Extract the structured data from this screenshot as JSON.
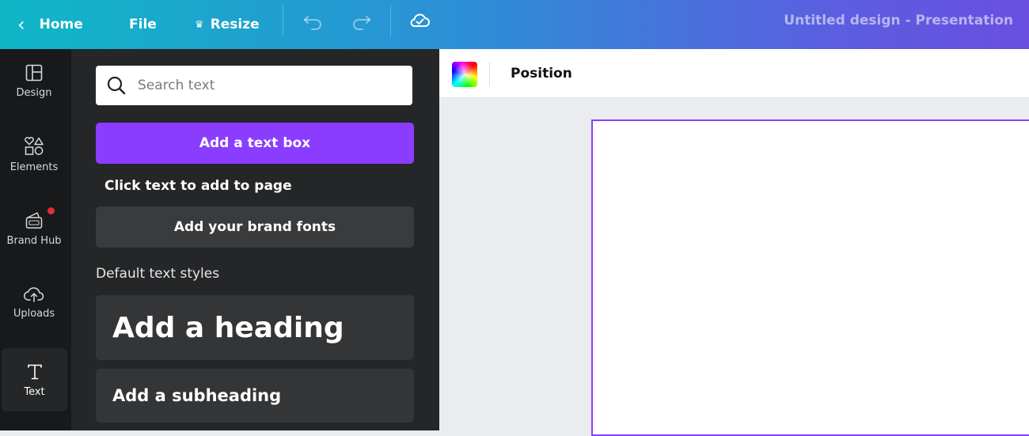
{
  "topbar": {
    "home_label": "Home",
    "file_label": "File",
    "resize_label": "Resize",
    "title": "Untitled design - Presentation"
  },
  "rail": {
    "items": [
      {
        "label": "Design",
        "icon": "layout-icon"
      },
      {
        "label": "Elements",
        "icon": "shapes-icon"
      },
      {
        "label": "Brand Hub",
        "icon": "brand-hub-icon"
      },
      {
        "label": "Uploads",
        "icon": "cloud-upload-icon"
      },
      {
        "label": "Text",
        "icon": "text-icon"
      }
    ]
  },
  "panel": {
    "search_placeholder": "Search text",
    "add_text_box": "Add a text box",
    "hint": "Click text to add to page",
    "brand_fonts": "Add your brand fonts",
    "section_title": "Default text styles",
    "heading": "Add a heading",
    "subheading": "Add a subheading"
  },
  "toolbar": {
    "position_label": "Position"
  },
  "colors": {
    "accent": "#8b3dff",
    "rail_bg": "#18191b",
    "panel_bg": "#252627"
  }
}
